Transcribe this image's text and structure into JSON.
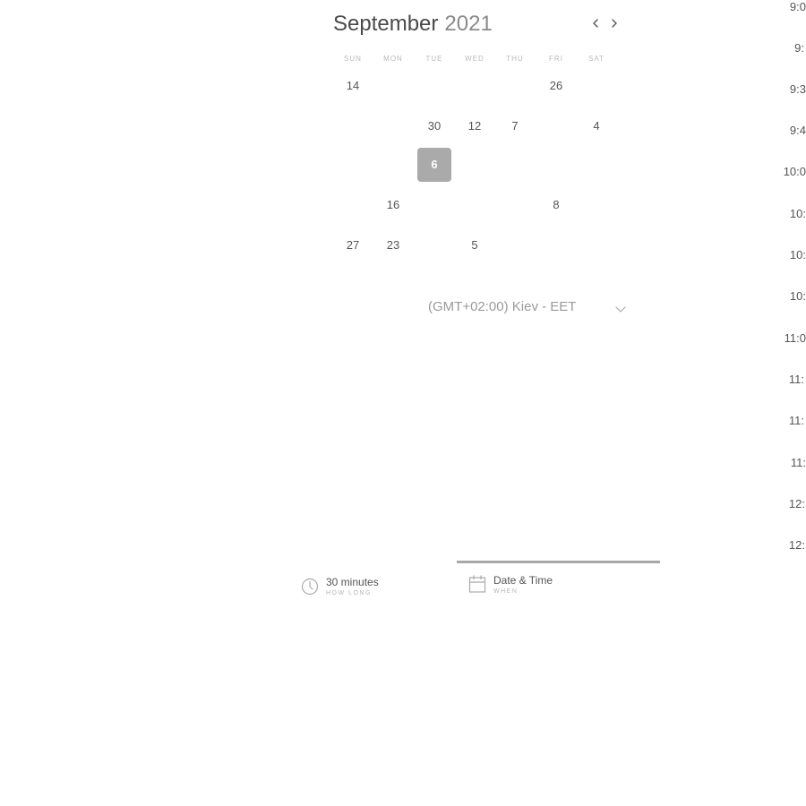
{
  "calendar": {
    "month": "September",
    "year": "2021",
    "weekdays": [
      "SUN",
      "MON",
      "TUE",
      "WED",
      "THU",
      "FRI",
      "SAT"
    ],
    "days": {
      "r1_sun": "14",
      "r1_fri": "26",
      "r2_tue": "30",
      "r2_wed": "12",
      "r2_thu": "7",
      "r2_sat": "4",
      "r3_tue": "6",
      "r4_mon": "16",
      "r4_fri": "8",
      "r5_sun": "27",
      "r5_mon": "23",
      "r5_wed": "5"
    },
    "selected_day": "6"
  },
  "timezone": {
    "label": "(GMT+02:00) Kiev - EET"
  },
  "times": [
    "9:0",
    "9:",
    "9:3",
    "9:4",
    "10:0",
    "10:",
    "10:",
    "10:",
    "11:0",
    "11:",
    "11:",
    "11:",
    "12:",
    "12:"
  ],
  "steps": {
    "duration_title": "30 minutes",
    "duration_sub": "HOW LONG",
    "when_title": "Date & Time",
    "when_sub": "WHEN"
  },
  "colors": {
    "selected_day_bg": "#aaaaaa",
    "active_step_underline": "#a8a8a8"
  },
  "icons": [
    "chevron-left-icon",
    "chevron-right-icon",
    "chevron-down-icon",
    "clock-icon",
    "calendar-icon"
  ]
}
